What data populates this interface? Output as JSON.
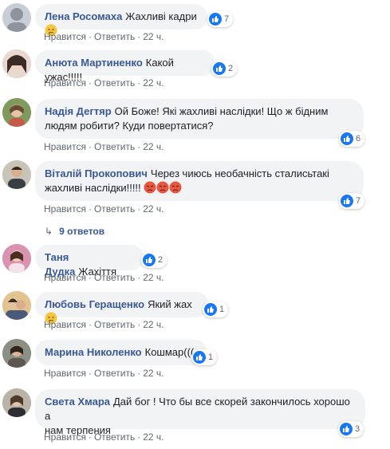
{
  "actions": {
    "like": "Нравится",
    "reply": "Ответить",
    "sep": "·"
  },
  "comments": [
    {
      "author": "Лена Росомаха",
      "text": "Жахливі кадри",
      "emoji": "sad",
      "reactions": "7",
      "time": "22 ч."
    },
    {
      "author": "Анюта Мартиненко",
      "text": "Какой ужас!!!!!",
      "emoji": "",
      "reactions": "2",
      "time": "22 ч."
    },
    {
      "author": "Надія Дегтяр",
      "text_line1": "Ой Боже! Які жахливі наслідки! Що ж бідним",
      "text_line2": "людям робити? Куди повертатися?",
      "reactions": "6",
      "time": "22 ч."
    },
    {
      "author": "Віталій Прокопович",
      "text_line1": "Через чиюсь необачність сталисьтакі",
      "text_line2": "жахливі наслідки!!!!!",
      "emoji": "angry",
      "reactions": "7",
      "time": "22 ч.",
      "replies": "9 ответов"
    },
    {
      "author": "Таня Дудка",
      "text": "Жахіття",
      "reactions": "2",
      "time": "22 ч."
    },
    {
      "author": "Любовь Геращенко",
      "text": "Який жах",
      "emoji": "sad",
      "reactions": "1",
      "time": "22 ч."
    },
    {
      "author": "Марина Николенко",
      "text": "Кошмар(((",
      "reactions": "1",
      "time": "22 ч."
    },
    {
      "author": "Света Хмара",
      "text_line1": "Дай бог ! Что бы все скорей закончилось хорошо а",
      "text_line2": "нам терпения",
      "reactions": "3",
      "time": "22 ч."
    }
  ],
  "colors": {
    "author": "#385898",
    "bubble": "#f2f3f5",
    "like_blue": "#1877f2",
    "meta": "#606770"
  }
}
